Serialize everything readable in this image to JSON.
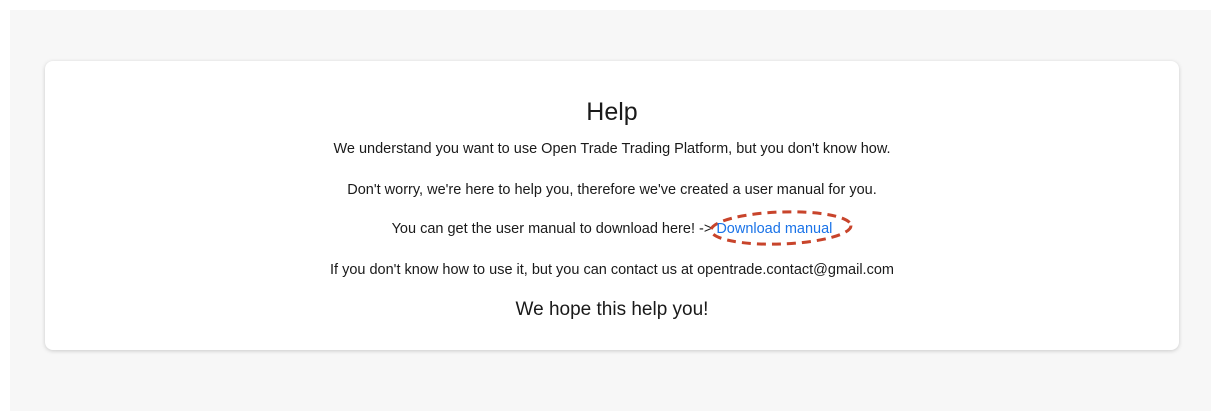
{
  "help": {
    "title": "Help",
    "line1": "We understand you want to use Open Trade Trading Platform, but you don't know how.",
    "line2": "Don't worry, we're here to help you, therefore we've created a user manual for you.",
    "line3_prefix": "You can get the user manual to download here! -> ",
    "download_link_label": "Download manual",
    "line4": "If you don't know how to use it, but you can contact us at opentrade.contact@gmail.com",
    "closing": "We hope this help you!"
  },
  "colors": {
    "link": "#1a73e8",
    "annotation_ring": "#c8442b",
    "page_background": "#f7f7f7",
    "card_background": "#ffffff"
  }
}
